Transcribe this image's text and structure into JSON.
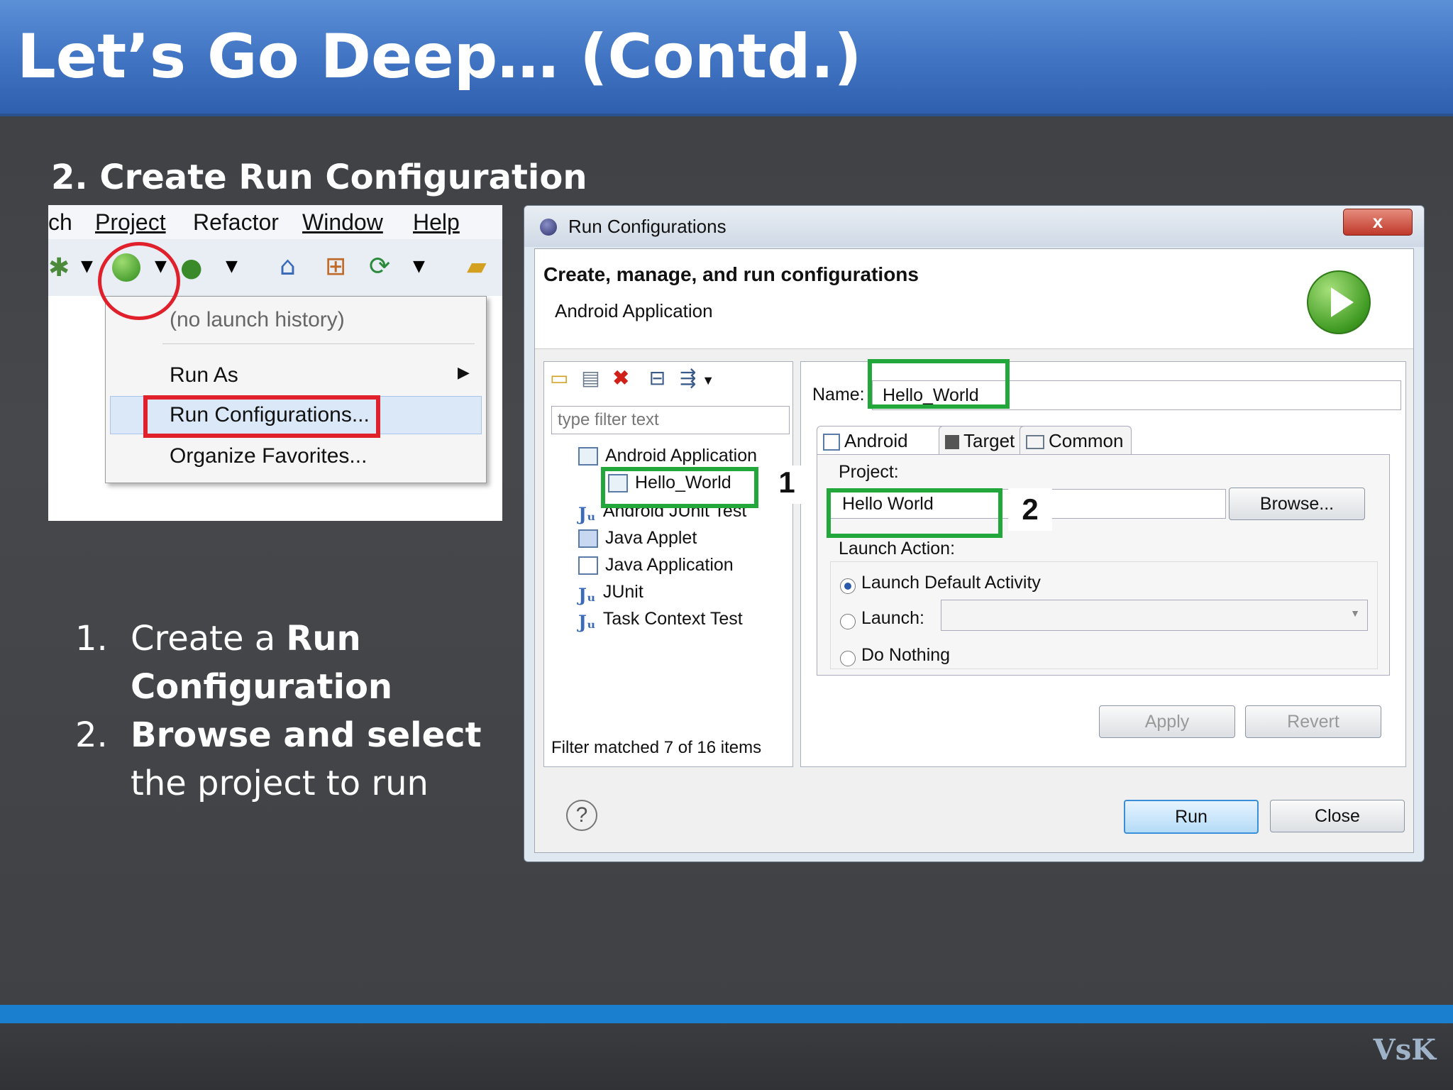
{
  "slide": {
    "title": "Let’s Go Deep… (Contd.)",
    "subtitle": "2. Create Run Configuration",
    "steps": [
      {
        "num": "1.",
        "prefix": "Create a ",
        "bold": "Run Configuration",
        "suffix": ""
      },
      {
        "num": "2.",
        "prefix": " ",
        "bold": "Browse and select",
        "suffix": " the project to run"
      }
    ],
    "footer_logo": "VsK"
  },
  "eclipse_menu": {
    "menubar": [
      "ch",
      "Project",
      "Refactor",
      "Window",
      "Help"
    ],
    "dropdown": {
      "no_history": "(no launch history)",
      "run_as": "Run As",
      "run_configurations": "Run Configurations...",
      "organize_favorites": "Organize Favorites..."
    }
  },
  "dialog": {
    "title": "Run Configurations",
    "close_label": "x",
    "header_title": "Create, manage, and run configurations",
    "header_subtitle": "Android Application",
    "filter_placeholder": "type filter text",
    "tree": [
      {
        "label": "Android Application",
        "icon": "android-config-icon"
      },
      {
        "label": "Hello_World",
        "icon": "android-config-icon"
      },
      {
        "label": "Android JUnit Test",
        "icon": "junit-icon"
      },
      {
        "label": "Java Applet",
        "icon": "applet-icon"
      },
      {
        "label": "Java Application",
        "icon": "java-app-icon"
      },
      {
        "label": "JUnit",
        "icon": "junit-icon"
      },
      {
        "label": "Task Context Test",
        "icon": "junit-icon"
      }
    ],
    "filter_status": "Filter matched 7 of 16 items",
    "name_label": "Name:",
    "name_value": "Hello_World",
    "tabs": [
      "Android",
      "Target",
      "Common"
    ],
    "project_label": "Project:",
    "project_value": "Hello World",
    "browse_label": "Browse...",
    "launch_action_label": "Launch Action:",
    "launch_options": [
      "Launch Default Activity",
      "Launch:",
      "Do Nothing"
    ],
    "selected_launch_option": "Launch Default Activity",
    "apply_label": "Apply",
    "revert_label": "Revert",
    "run_label": "Run",
    "close_button_label": "Close",
    "help_symbol": "?",
    "callout_1": "1",
    "callout_2": "2"
  },
  "colors": {
    "title_blue": "#3f73c2",
    "highlight_red": "#e0202a",
    "highlight_green": "#22a83a",
    "band_blue": "#1b7fd0"
  }
}
